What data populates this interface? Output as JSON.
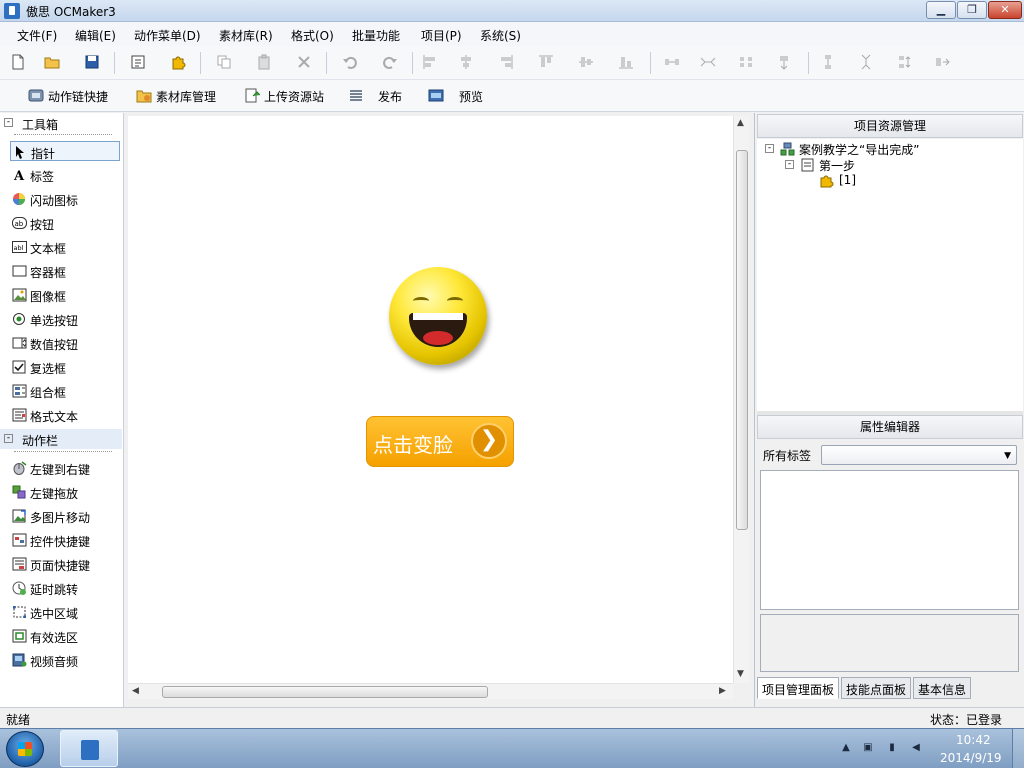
{
  "window": {
    "title": "傲思 OCMaker3",
    "min_label": "▁",
    "max_label": "❐",
    "close_label": "✕"
  },
  "menu": {
    "items": [
      "文件(F)",
      "编辑(E)",
      "动作菜单(D)",
      "素材库(R)",
      "格式(O)",
      "批量功能",
      "项目(P)",
      "系统(S)"
    ]
  },
  "toolbar2": {
    "action_chain": "动作链快捷",
    "material_mgmt": "素材库管理",
    "upload": "上传资源站",
    "publish": "发布",
    "preview": "预览"
  },
  "toolbox": {
    "title": "工具箱",
    "items": [
      "指针",
      "标签",
      "闪动图标",
      "按钮",
      "文本框",
      "容器框",
      "图像框",
      "单选按钮",
      "数值按钮",
      "复选框",
      "组合框",
      "格式文本"
    ]
  },
  "actionbar": {
    "title": "动作栏",
    "items": [
      "左键到右键",
      "左键拖放",
      "多图片移动",
      "控件快捷键",
      "页面快捷键",
      "延时跳转",
      "选中区域",
      "有效选区",
      "视频音频"
    ]
  },
  "canvas": {
    "button_label": "点击变脸",
    "button_arrow": "❯"
  },
  "project_panel": {
    "title": "项目资源管理",
    "root": "案例教学之“导出完成”",
    "step": "第一步",
    "leaf": "[1]"
  },
  "property_panel": {
    "title": "属性编辑器",
    "tag_label": "所有标签",
    "tag_value": ""
  },
  "tabs": [
    "项目管理面板",
    "技能点面板",
    "基本信息"
  ],
  "status": {
    "left": "就绪",
    "right": "状态：已登录"
  },
  "taskbar": {
    "time": "10:42",
    "date": "2014/9/19"
  }
}
